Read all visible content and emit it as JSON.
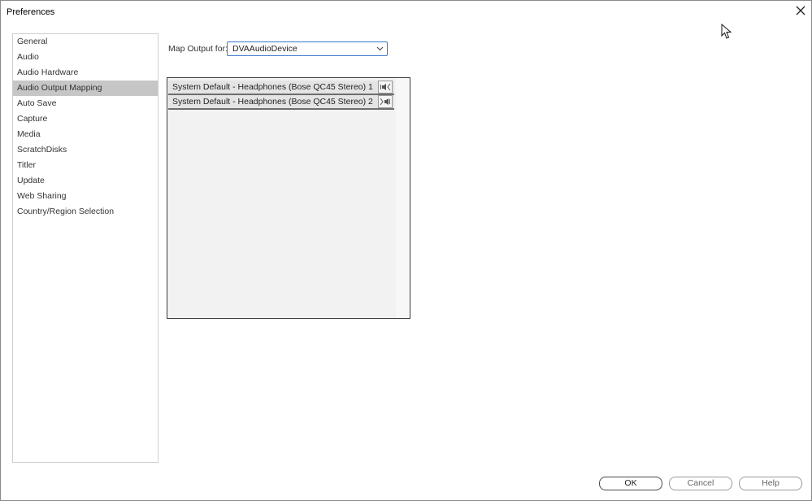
{
  "window": {
    "title": "Preferences",
    "close_icon": "close-icon"
  },
  "sidebar": {
    "items": [
      {
        "label": "General",
        "selected": false
      },
      {
        "label": "Audio",
        "selected": false
      },
      {
        "label": "Audio Hardware",
        "selected": false
      },
      {
        "label": "Audio Output Mapping",
        "selected": true
      },
      {
        "label": "Auto Save",
        "selected": false
      },
      {
        "label": "Capture",
        "selected": false
      },
      {
        "label": "Media",
        "selected": false
      },
      {
        "label": "ScratchDisks",
        "selected": false
      },
      {
        "label": "Titler",
        "selected": false
      },
      {
        "label": "Update",
        "selected": false
      },
      {
        "label": "Web Sharing",
        "selected": false
      },
      {
        "label": "Country/Region Selection",
        "selected": false
      }
    ]
  },
  "main": {
    "map_output_label": "Map Output for:",
    "device_select": {
      "value": "DVAAudioDevice",
      "icon": "chevron-down-icon"
    },
    "channels": [
      {
        "label": "System Default - Headphones (Bose QC45 Stereo) 1",
        "icon": "speaker-left-icon"
      },
      {
        "label": "System Default - Headphones (Bose QC45 Stereo) 2",
        "icon": "speaker-right-icon"
      }
    ]
  },
  "footer": {
    "ok_label": "OK",
    "cancel_label": "Cancel",
    "help_label": "Help"
  },
  "colors": {
    "selection": "#c6c6c6",
    "focus_border": "#3c78c8",
    "panel_bg": "#f2f2f2"
  }
}
